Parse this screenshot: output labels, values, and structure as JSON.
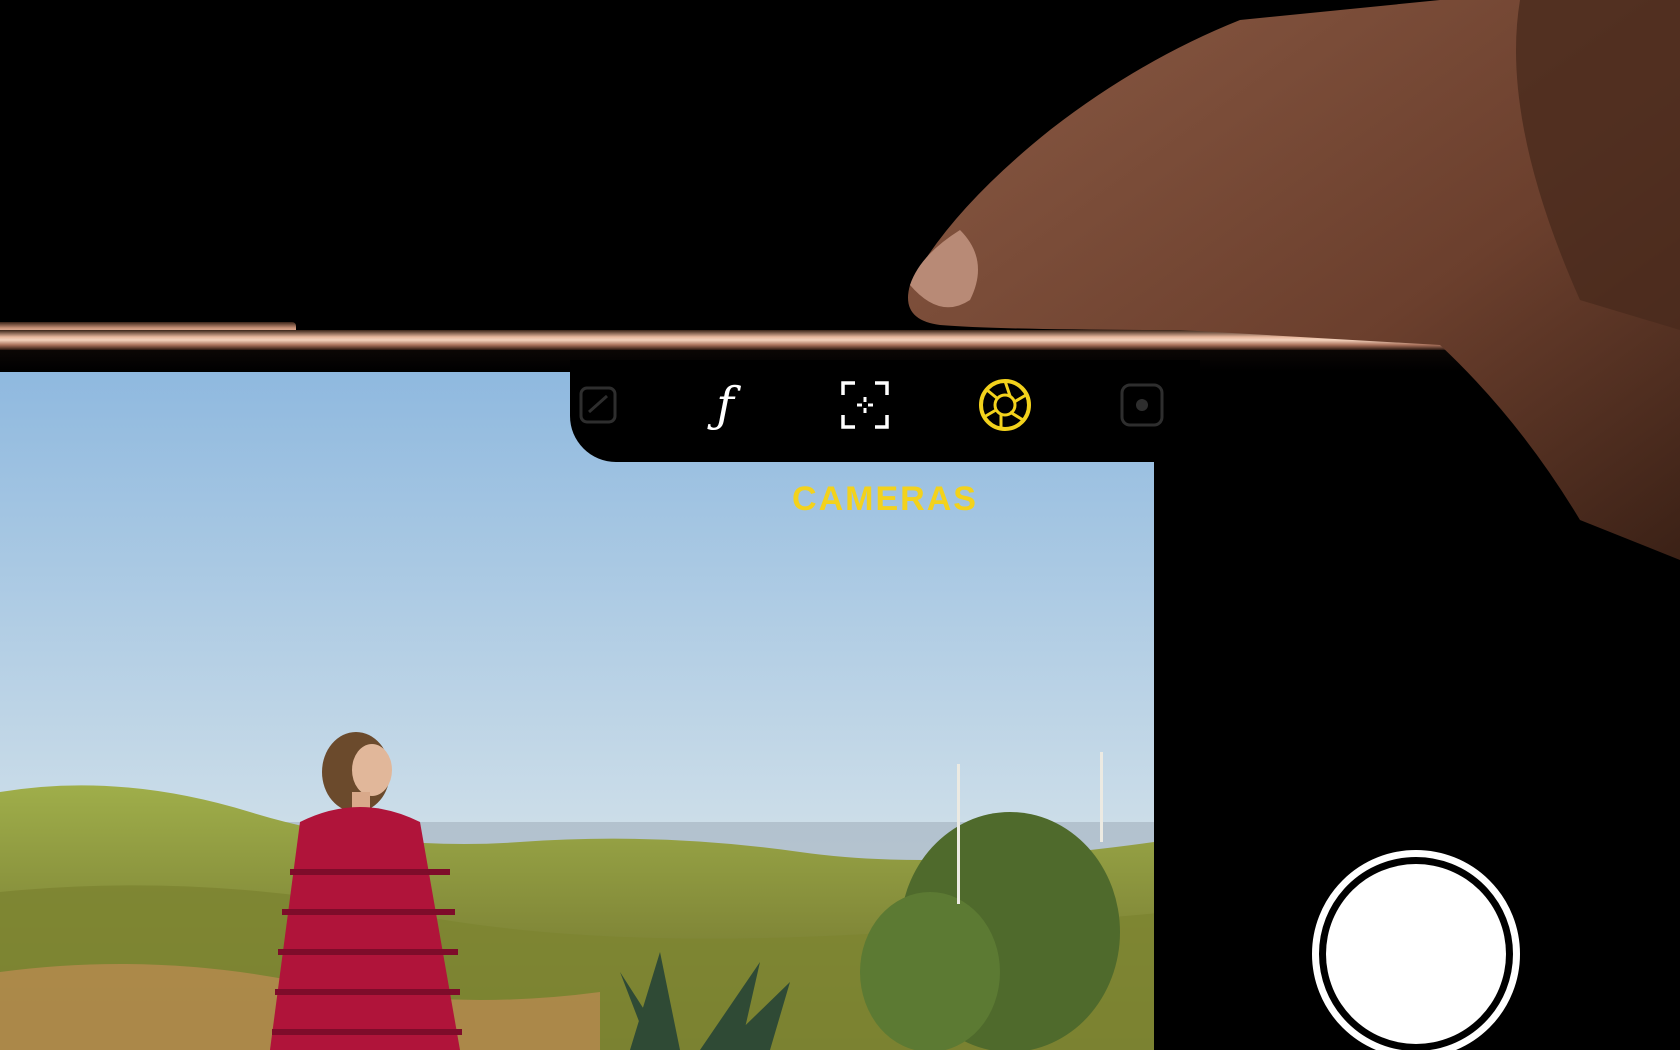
{
  "camera_controls": {
    "items": [
      {
        "icon": "exposure-icon",
        "active": false
      },
      {
        "icon": "aperture-f-icon",
        "label": "ƒ",
        "active": false
      },
      {
        "icon": "focus-frame-icon",
        "active": false
      },
      {
        "icon": "camera-lens-icon",
        "active": true
      },
      {
        "icon": "style-icon",
        "active": false
      }
    ],
    "selected_label": "CAMERAS"
  },
  "colors": {
    "accent_yellow": "#f3d21c",
    "phone_frame": "#e8b89e",
    "sky": "#9fc2e2",
    "dress": "#b0143a"
  },
  "shutter": {
    "icon": "shutter-button"
  }
}
